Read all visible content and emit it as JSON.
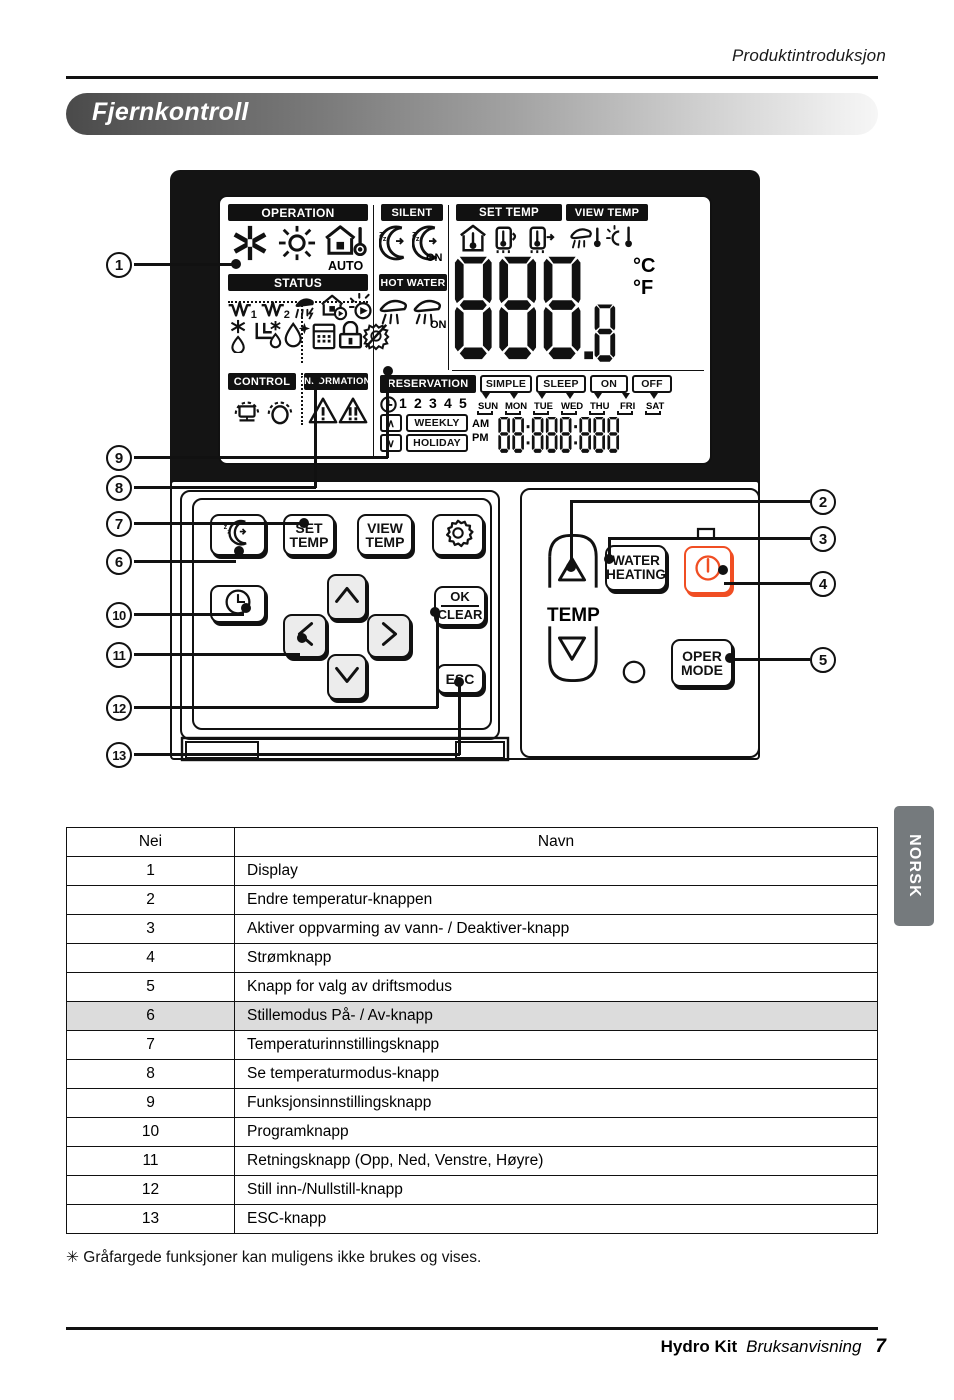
{
  "header": {
    "chapter": "Produktintroduksjon",
    "title": "Fjernkontroll"
  },
  "display": {
    "sections": {
      "operation": "OPERATION",
      "status": "STATUS",
      "control": "CONTROL",
      "information": "INFORMATION",
      "silent": "SILENT",
      "hot_water": "HOT WATER",
      "set_temp": "SET TEMP",
      "view_temp": "VIEW TEMP",
      "reservation": "RESERVATION"
    },
    "operation_icons": [
      "snowflake-cool-icon",
      "sun-heat-icon",
      "house-thermometer-auto-icon"
    ],
    "operation_auto_label": "AUTO",
    "silent_icons": [
      "sleep-moon-icon",
      "sleep-moon-on-icon"
    ],
    "silent_on_label": "ON",
    "hot_water_icons": [
      "shower-icon",
      "shower-on-icon"
    ],
    "hot_water_on_label": "ON",
    "status_icons_row1": [
      "w1-icon",
      "w2-icon",
      "shower-flash-icon",
      "house-play-icon",
      "sun-play-icon"
    ],
    "status_labels_row1": [
      "1",
      "2"
    ],
    "status_icons_row2": [
      "frost-drop-icon",
      "floor-heat-drop-icon",
      "drop-sparkle-icon",
      "calendar-icon",
      "lock-icon",
      "no-filter-icon"
    ],
    "control_icons": [
      "unit-control-icon",
      "circle-control-icon"
    ],
    "information_icons": [
      "warning-single-icon",
      "warning-double-icon"
    ],
    "set_temp_icons": [
      "house-temp-icon",
      "inlet-temp-icon",
      "outlet-temp-icon"
    ],
    "view_temp_icons": [
      "shower-temp-icon",
      "solar-temp-icon"
    ],
    "temp_units": [
      "°C",
      "°F"
    ],
    "temp_value": "888.8",
    "schedule_buttons": [
      "SIMPLE",
      "SLEEP",
      "ON",
      "OFF"
    ],
    "weekdays": [
      "SUN",
      "MON",
      "TUE",
      "WED",
      "THU",
      "FRI",
      "SAT"
    ],
    "reservation_numbers": [
      "1",
      "2",
      "3",
      "4",
      "5"
    ],
    "weekly_label": "WEEKLY",
    "holiday_label": "HOLIDAY",
    "am_label": "AM",
    "pm_label": "PM",
    "clock_value": "88:888:888"
  },
  "buttons": {
    "silent_mode": "sleep-moon-button",
    "set_temp": "SET\nTEMP",
    "set_temp_line1": "SET",
    "set_temp_line2": "TEMP",
    "view_temp_line1": "VIEW",
    "view_temp_line2": "TEMP",
    "function_setting": "gear-button",
    "program": "clock-button",
    "ok": "OK",
    "clear": "CLEAR",
    "esc": "ESC",
    "arrow_up": "∧",
    "arrow_down": "∨",
    "arrow_left": "〈",
    "arrow_right": "〉",
    "temp_label": "TEMP",
    "temp_up": "△",
    "temp_down": "▽",
    "water_heating_line1": "WATER",
    "water_heating_line2": "HEATING",
    "power": "power-button",
    "oper_mode_line1": "OPER",
    "oper_mode_line2": "MODE"
  },
  "callouts": [
    "1",
    "2",
    "3",
    "4",
    "5",
    "6",
    "7",
    "8",
    "9",
    "10",
    "11",
    "12",
    "13"
  ],
  "table": {
    "headers": [
      "Nei",
      "Navn"
    ],
    "rows": [
      {
        "no": "1",
        "name": "Display"
      },
      {
        "no": "2",
        "name": "Endre temperatur-knappen"
      },
      {
        "no": "3",
        "name": "Aktiver oppvarming av vann- / Deaktiver-knapp"
      },
      {
        "no": "4",
        "name": "Strømknapp"
      },
      {
        "no": "5",
        "name": "Knapp for valg av driftsmodus"
      },
      {
        "no": "6",
        "name": "Stillemodus På- / Av-knapp",
        "highlight": true
      },
      {
        "no": "7",
        "name": "Temperaturinnstillingsknapp"
      },
      {
        "no": "8",
        "name": "Se temperaturmodus-knapp"
      },
      {
        "no": "9",
        "name": "Funksjonsinnstillingsknapp"
      },
      {
        "no": "10",
        "name": "Programknapp"
      },
      {
        "no": "11",
        "name": "Retningsknapp (Opp, Ned, Venstre, Høyre)"
      },
      {
        "no": "12",
        "name": "Still inn-/Nullstill-knapp"
      },
      {
        "no": "13",
        "name": "ESC-knapp"
      }
    ]
  },
  "footnote": "✳ Gråfargede funksjoner kan muligens ikke brukes og vises.",
  "lang_tab": "NORSK",
  "footer": {
    "brand": "Hydro Kit",
    "doc": "Bruksanvisning",
    "page": "7"
  },
  "colors": {
    "power_accent": "#f04e23",
    "banner_dark": "#4a4a4a",
    "lang_tab_bg": "#757a7d",
    "highlight_row": "#dcdcdc"
  }
}
